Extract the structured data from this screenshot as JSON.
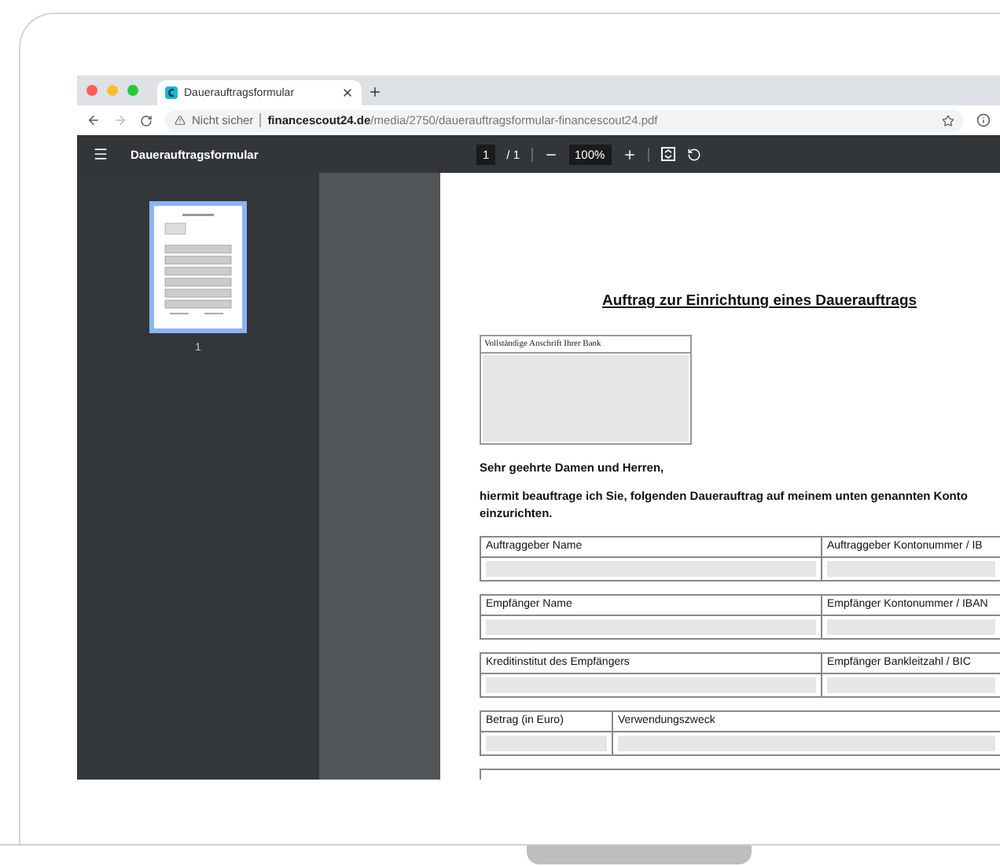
{
  "browser": {
    "tabs": [
      {
        "title": "Dauerauftragsformular",
        "selected": true
      }
    ],
    "security": "Nicht sicher",
    "url_domain": "financescout24.de",
    "url_path": "/media/2750/dauerauftragsformular-financescout24.pdf"
  },
  "pdf_toolbar": {
    "title": "Dauerauftragsformular",
    "page": "1",
    "page_total": "/ 1",
    "zoom": "100%"
  },
  "sidebar": {
    "thumbnails": [
      {
        "label": "1",
        "selected": true
      }
    ]
  },
  "document": {
    "title": "Auftrag zur Einrichtung eines Dauerauftrags",
    "address_box_label": "Vollständige Anschrift Ihrer Bank",
    "greeting": "Sehr geehrte Damen und Herren,",
    "intro": "hiermit beauftrage ich Sie, folgenden Dauerauftrag auf meinem unten genannten Konto einzurichten.",
    "field_rows": [
      {
        "fields": [
          {
            "label": "Auftraggeber Name",
            "kind": "wide"
          },
          {
            "label": "Auftraggeber Kontonummer / IB",
            "kind": "narrow"
          }
        ]
      },
      {
        "fields": [
          {
            "label": "Empfänger Name",
            "kind": "wide"
          },
          {
            "label": "Empfänger Kontonummer / IBAN",
            "kind": "narrow"
          }
        ]
      },
      {
        "fields": [
          {
            "label": "Kreditinstitut des Empfängers",
            "kind": "wide"
          },
          {
            "label": "Empfänger Bankleitzahl / BIC",
            "kind": "narrow"
          }
        ]
      },
      {
        "fields": [
          {
            "label": "Betrag (in Euro)",
            "kind": "short"
          },
          {
            "label": "Verwendungszweck",
            "kind": "wide"
          }
        ]
      }
    ]
  }
}
